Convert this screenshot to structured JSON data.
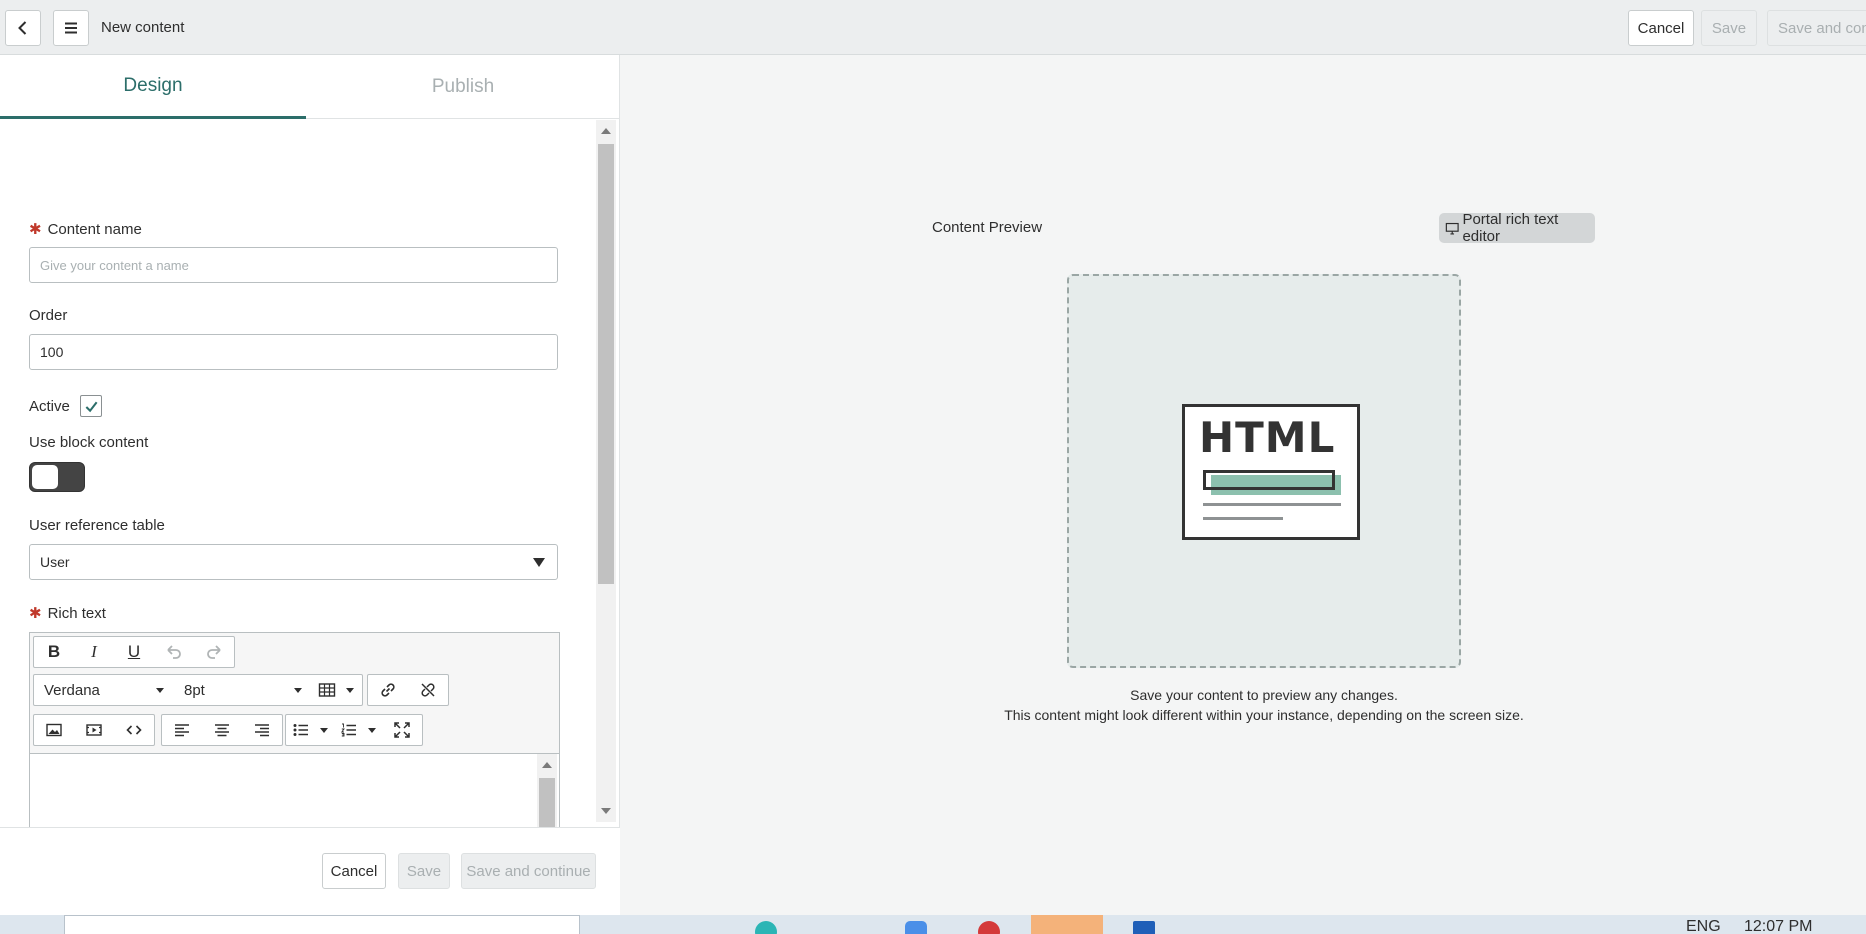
{
  "header": {
    "title": "New content",
    "cancel_label": "Cancel",
    "save_label": "Save",
    "save_continue_label": "Save and conti"
  },
  "tabs": [
    {
      "label": "Design",
      "active": true
    },
    {
      "label": "Publish",
      "active": false
    }
  ],
  "form": {
    "content_name": {
      "label": "Content name",
      "required": true,
      "value": "",
      "placeholder": "Give your content a name"
    },
    "order": {
      "label": "Order",
      "value": "100"
    },
    "active": {
      "label": "Active",
      "checked": true
    },
    "use_block_content": {
      "label": "Use block content",
      "on": false
    },
    "user_reference_table": {
      "label": "User reference table",
      "value": "User"
    },
    "rich_text": {
      "label": "Rich text",
      "required": true,
      "font_family": "Verdana",
      "font_size": "8pt",
      "toolbar_row1": [
        "bold-icon",
        "italic-icon",
        "underline-icon",
        "undo-icon",
        "redo-icon"
      ],
      "toolbar_row2": [
        "table-icon",
        "link-icon",
        "unlink-icon"
      ],
      "toolbar_row3": [
        "image-icon",
        "video-icon",
        "code-icon",
        "align-left-icon",
        "align-center-icon",
        "align-right-icon",
        "bullet-list-icon",
        "numbered-list-icon",
        "fullscreen-icon"
      ],
      "bold_glyph": "B",
      "italic_glyph": "I",
      "underline_glyph": "U"
    }
  },
  "footer": {
    "cancel_label": "Cancel",
    "save_label": "Save",
    "save_continue_label": "Save and continue"
  },
  "preview": {
    "label": "Content Preview",
    "editor_chip": "Portal rich text editor",
    "illustration_text": "HTML",
    "note_line1": "Save your content to preview any changes.",
    "note_line2": "This content might look different within your instance, depending on the screen size."
  },
  "taskbar": {
    "lang": "ENG",
    "time": "12:07 PM"
  },
  "colors": {
    "accent": "#2c6e6a",
    "required": "#c0392b",
    "illustration_green": "#8cc0ae",
    "disabled_text": "#a9afb1"
  }
}
